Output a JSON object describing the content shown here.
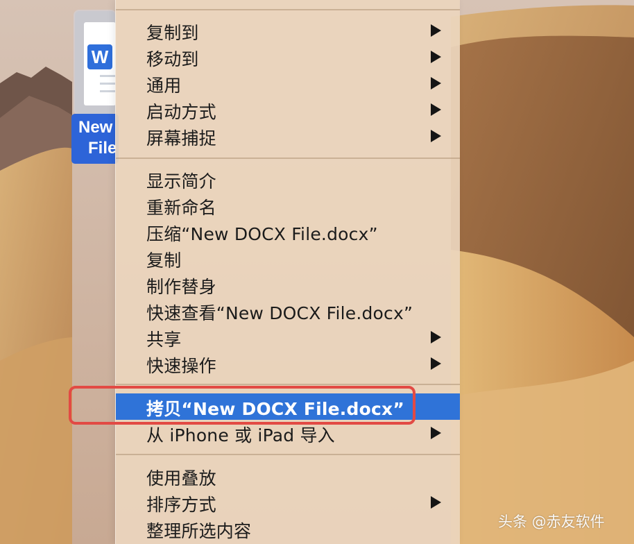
{
  "desktop": {
    "file_label_line1": "New",
    "file_label_line2": "File",
    "doc_badge": "W"
  },
  "menu": {
    "items": [
      {
        "label": "复制到",
        "has_submenu": true
      },
      {
        "label": "移动到",
        "has_submenu": true
      },
      {
        "label": "通用",
        "has_submenu": true
      },
      {
        "label": "启动方式",
        "has_submenu": true
      },
      {
        "label": "屏幕捕捉",
        "has_submenu": true
      },
      {
        "label": "显示简介",
        "has_submenu": false
      },
      {
        "label": "重新命名",
        "has_submenu": false
      },
      {
        "label": "压缩“New DOCX File.docx”",
        "has_submenu": false
      },
      {
        "label": "复制",
        "has_submenu": false
      },
      {
        "label": "制作替身",
        "has_submenu": false
      },
      {
        "label": "快速查看“New DOCX File.docx”",
        "has_submenu": false
      },
      {
        "label": "共享",
        "has_submenu": true
      },
      {
        "label": "快速操作",
        "has_submenu": true
      },
      {
        "label": "拷贝“New DOCX File.docx”",
        "has_submenu": false,
        "selected": true
      },
      {
        "label": "从 iPhone 或 iPad 导入",
        "has_submenu": true
      },
      {
        "label": "使用叠放",
        "has_submenu": false
      },
      {
        "label": "排序方式",
        "has_submenu": true
      },
      {
        "label": "整理所选内容",
        "has_submenu": false
      }
    ]
  },
  "watermark": {
    "text": "头条 @赤友软件"
  },
  "colors": {
    "menu_background": "#ECD6BE",
    "selected": "#2F73D8",
    "highlight_outline": "#E24A44",
    "label_bg": "#2D64D8"
  },
  "icons": {
    "submenu_arrow": "triangle-right-icon",
    "document": "word-document-icon"
  }
}
